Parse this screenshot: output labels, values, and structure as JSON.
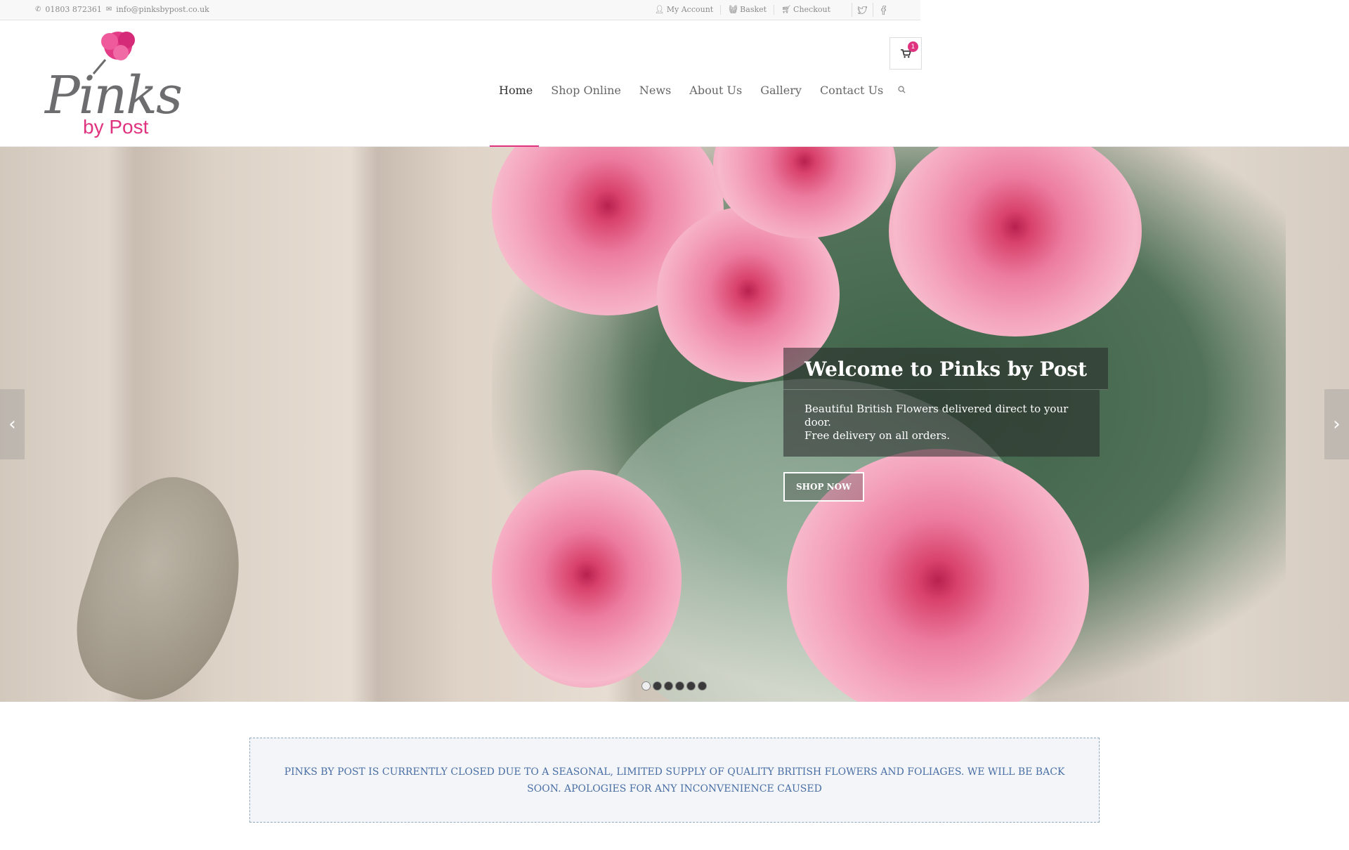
{
  "topbar": {
    "phone": "01803 872361",
    "email": "info@pinksbypost.co.uk",
    "my_account": "My Account",
    "basket": "Basket",
    "checkout": "Checkout",
    "icons": [
      "phone-icon",
      "envelope-icon",
      "user-icon",
      "basket-icon",
      "cart-icon",
      "twitter-icon",
      "facebook-icon"
    ]
  },
  "header": {
    "logo_word": "Pinks",
    "logo_sub": "by Post",
    "cart_count": "1",
    "nav": [
      "Home",
      "Shop Online",
      "News",
      "About Us",
      "Gallery",
      "Contact Us"
    ],
    "active_nav": "Home",
    "accent_color": "#e0337f"
  },
  "hero": {
    "title": "Welcome to Pinks by Post",
    "subtitle_line1": "Beautiful British Flowers delivered direct to your door.",
    "subtitle_line2": "Free delivery on all orders.",
    "button": "SHOP NOW",
    "slide_count": 6,
    "active_slide": 1
  },
  "notice": {
    "text": "PINKS BY POST IS CURRENTLY CLOSED DUE TO A SEASONAL, LIMITED SUPPLY OF QUALITY BRITISH FLOWERS AND FOLIAGES. WE WILL BE BACK SOON. APOLOGIES FOR ANY INCONVENIENCE CAUSED",
    "text_color": "#4a6fa5"
  }
}
